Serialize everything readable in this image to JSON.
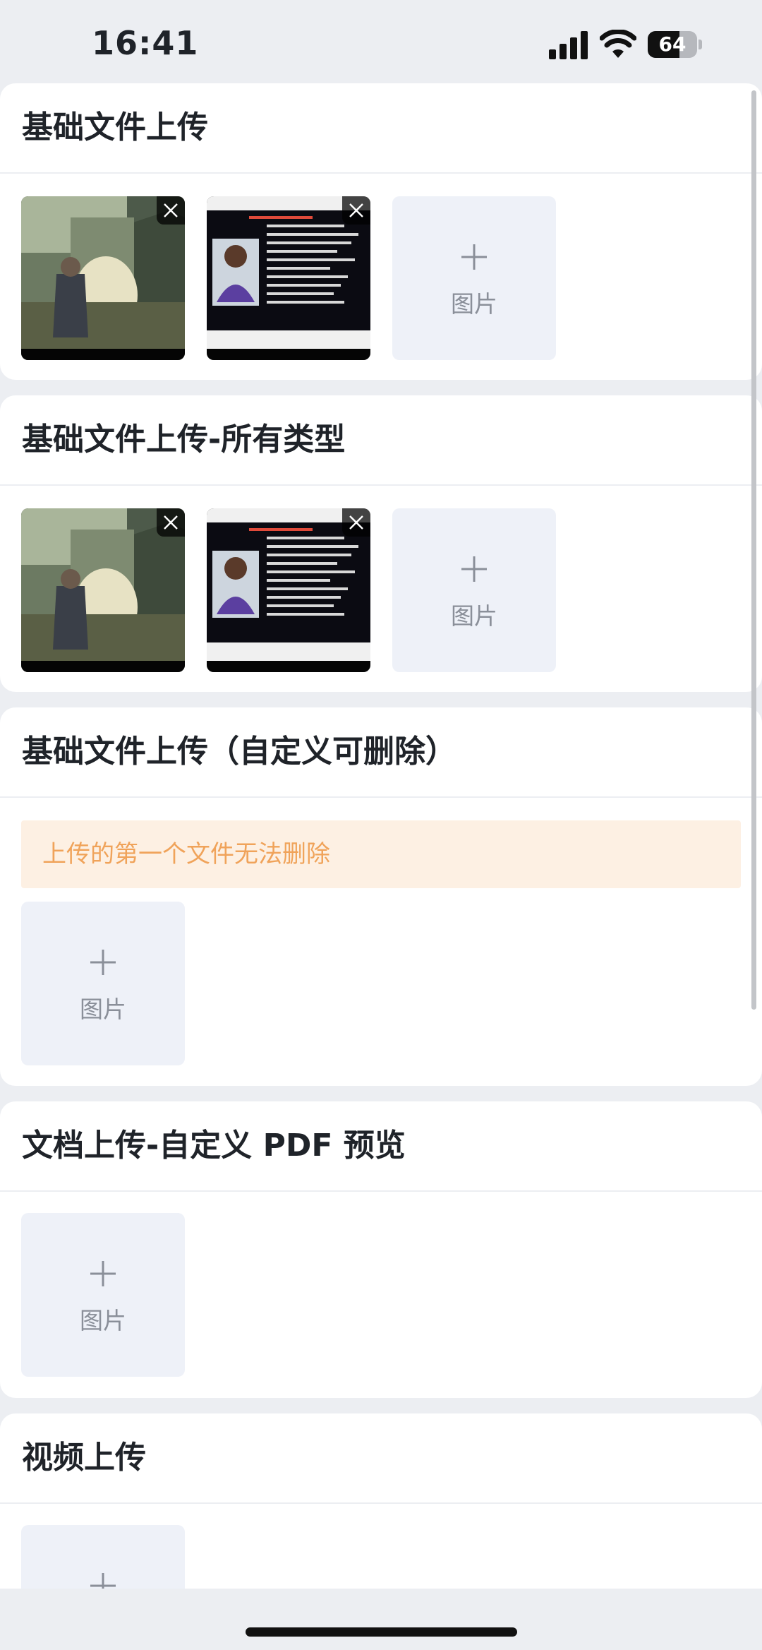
{
  "status_bar": {
    "time": "16:41",
    "battery": "64",
    "battery_level": 0.64
  },
  "sections": [
    {
      "title": "基础文件上传",
      "add_label": "图片"
    },
    {
      "title": "基础文件上传-所有类型",
      "add_label": "图片"
    },
    {
      "title": "基础文件上传（自定义可删除）",
      "notice": "上传的第一个文件无法删除",
      "add_label": "图片"
    },
    {
      "title": "文档上传-自定义 PDF 预览",
      "add_label": "图片"
    },
    {
      "title": "视频上传"
    }
  ],
  "icons": {
    "delete": "close-icon",
    "add": "plus-icon",
    "signal": "cellular-signal-icon",
    "wifi": "wifi-icon",
    "battery": "battery-icon"
  },
  "colors": {
    "page_bg": "#eceef2",
    "card_bg": "#ffffff",
    "tile_bg": "#eef1f8",
    "notice_bg": "#fdf0e3",
    "notice_text": "#f0a35a"
  }
}
